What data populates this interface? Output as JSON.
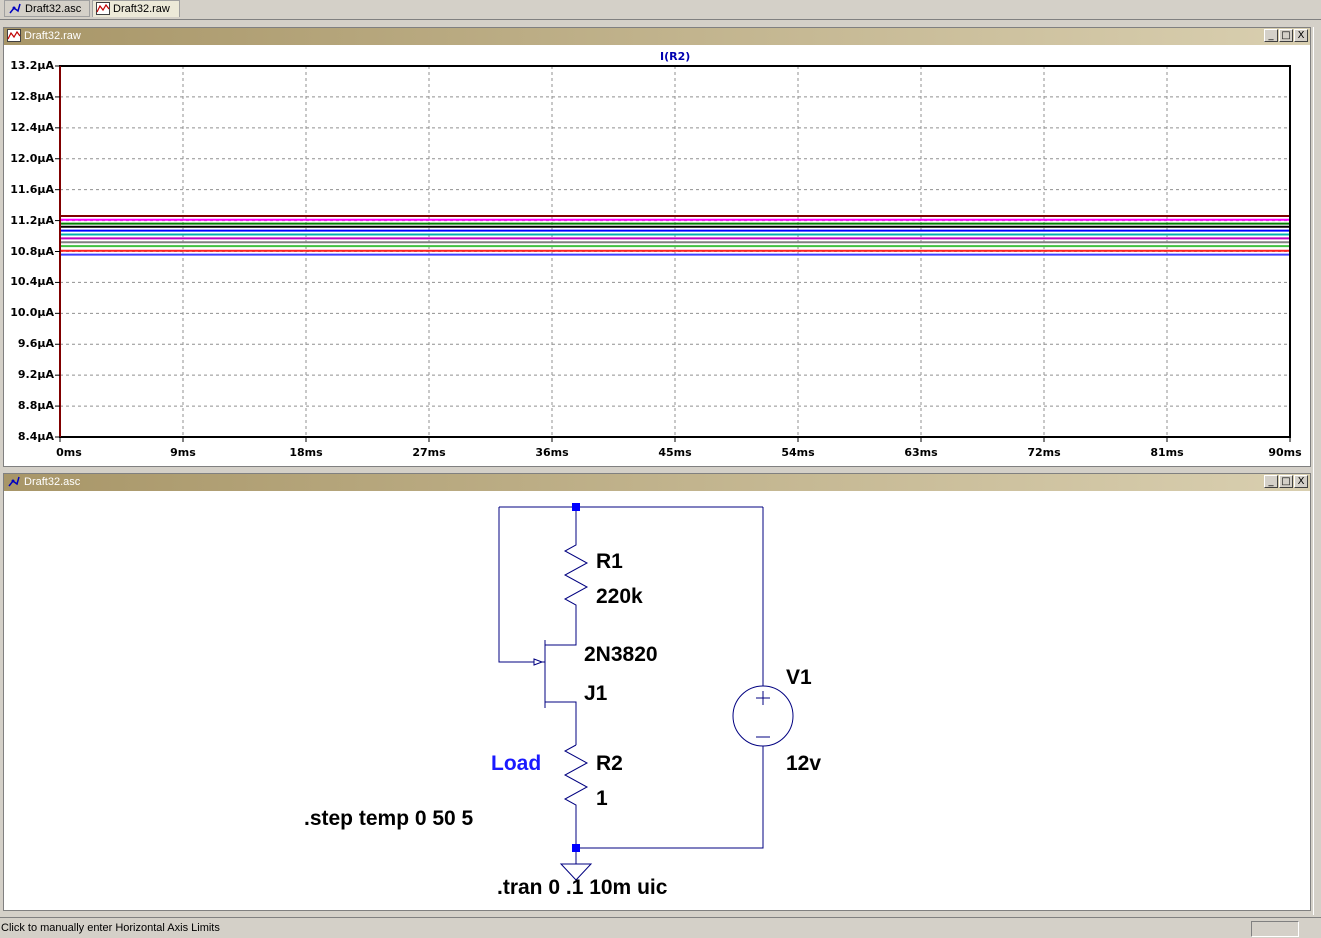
{
  "tabs": [
    {
      "label": "Draft32.asc",
      "active": false
    },
    {
      "label": "Draft32.raw",
      "active": true
    }
  ],
  "plot_window": {
    "title": "Draft32.raw",
    "trace_title": "I(R2)",
    "buttons": [
      "_",
      "□",
      "X"
    ]
  },
  "schematic_window": {
    "title": "Draft32.asc",
    "buttons": [
      "_",
      "□",
      "X"
    ],
    "labels": {
      "r1_name": "R1",
      "r1_value": "220k",
      "j1_model": "2N3820",
      "j1_name": "J1",
      "net_label": "Load",
      "r2_name": "R2",
      "r2_value": "1",
      "v1_name": "V1",
      "v1_value": "12v",
      "step_directive": ".step temp 0 50 5",
      "tran_directive": ".tran 0 .1 10m uic"
    }
  },
  "status": {
    "text": "Click to manually enter Horizontal Axis Limits"
  },
  "chart_data": {
    "type": "line",
    "title": "I(R2)",
    "xlabel": "",
    "ylabel": "",
    "x_unit": "ms",
    "y_unit": "µA",
    "xlim": [
      0,
      90
    ],
    "ylim": [
      8.4,
      13.2
    ],
    "x_ticks": [
      "0ms",
      "9ms",
      "18ms",
      "27ms",
      "36ms",
      "45ms",
      "54ms",
      "63ms",
      "72ms",
      "81ms",
      "90ms"
    ],
    "y_ticks": [
      "13.2µA",
      "12.8µA",
      "12.4µA",
      "12.0µA",
      "11.6µA",
      "11.2µA",
      "10.8µA",
      "10.4µA",
      "10.0µA",
      "9.6µA",
      "9.2µA",
      "8.8µA",
      "8.4µA"
    ],
    "y_tick_values": [
      13.2,
      12.8,
      12.4,
      12.0,
      11.6,
      11.2,
      10.8,
      10.4,
      10.0,
      9.6,
      9.2,
      8.8,
      8.4
    ],
    "x_tick_values": [
      0,
      9,
      18,
      27,
      36,
      45,
      54,
      63,
      72,
      81,
      90
    ],
    "grid": true,
    "series": [
      {
        "color": "#800000",
        "x": [
          0,
          90
        ],
        "values": [
          11.26,
          11.26
        ]
      },
      {
        "color": "#ff00ff",
        "x": [
          0,
          90
        ],
        "values": [
          11.21,
          11.21
        ]
      },
      {
        "color": "#008000",
        "x": [
          0,
          90
        ],
        "values": [
          11.16,
          11.16
        ]
      },
      {
        "color": "#000000",
        "x": [
          0,
          90
        ],
        "values": [
          11.12,
          11.12
        ]
      },
      {
        "color": "#0000ff",
        "x": [
          0,
          90
        ],
        "values": [
          11.07,
          11.07
        ]
      },
      {
        "color": "#00b0b0",
        "x": [
          0,
          90
        ],
        "values": [
          11.02,
          11.02
        ]
      },
      {
        "color": "#c000c0",
        "x": [
          0,
          90
        ],
        "values": [
          10.97,
          10.97
        ]
      },
      {
        "color": "#808080",
        "x": [
          0,
          90
        ],
        "values": [
          10.92,
          10.92
        ]
      },
      {
        "color": "#40c040",
        "x": [
          0,
          90
        ],
        "values": [
          10.87,
          10.87
        ]
      },
      {
        "color": "#ff2020",
        "x": [
          0,
          90
        ],
        "values": [
          10.81,
          10.81
        ]
      },
      {
        "color": "#4040ff",
        "x": [
          0,
          90
        ],
        "values": [
          10.76,
          10.76
        ]
      }
    ]
  }
}
